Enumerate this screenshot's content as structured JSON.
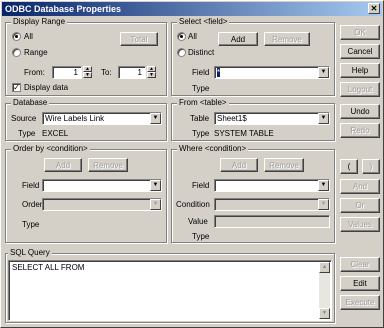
{
  "window": {
    "title": "ODBC Database Properties",
    "close_glyph": "✕"
  },
  "display_range": {
    "legend": "Display Range",
    "all_label": "All",
    "range_label": "Range",
    "total_label": "Total",
    "from_label": "From:",
    "from_value": "1",
    "to_label": "To:",
    "to_value": "1",
    "display_data_label": "Display data"
  },
  "select_field": {
    "legend": "Select <field>",
    "all_label": "All",
    "distinct_label": "Distinct",
    "add_label": "Add",
    "remove_label": "Remove",
    "field_label": "Field",
    "field_value": "*",
    "type_label": "Type"
  },
  "database": {
    "legend": "Database",
    "source_label": "Source",
    "source_value": "Wire Labels Link",
    "type_label": "Type",
    "type_value": "EXCEL"
  },
  "from_table": {
    "legend": "From <table>",
    "table_label": "Table",
    "table_value": "Sheet1$",
    "type_label": "Type",
    "type_value": "SYSTEM TABLE"
  },
  "order_by": {
    "legend": "Order by <condition>",
    "add_label": "Add",
    "remove_label": "Remove",
    "field_label": "Field",
    "order_label": "Order",
    "type_label": "Type"
  },
  "where": {
    "legend": "Where <condition>",
    "add_label": "Add",
    "remove_label": "Remove",
    "field_label": "Field",
    "condition_label": "Condition",
    "value_label": "Value",
    "type_label": "Type"
  },
  "sql": {
    "legend": "SQL Query",
    "text": "SELECT ALL FROM"
  },
  "side_buttons": {
    "ok": "OK",
    "cancel": "Cancel",
    "help": "Help",
    "logout": "Logout",
    "undo": "Undo",
    "redo": "Redo",
    "paren_open": "(",
    "paren_close": ")",
    "and": "And",
    "or": "Or",
    "values": "Values",
    "clear": "Clear",
    "edit": "Edit",
    "execute": "Execute"
  },
  "icons": {
    "dropdown": "▼",
    "spin_up": "▲",
    "spin_down": "▼",
    "check": "✓"
  }
}
